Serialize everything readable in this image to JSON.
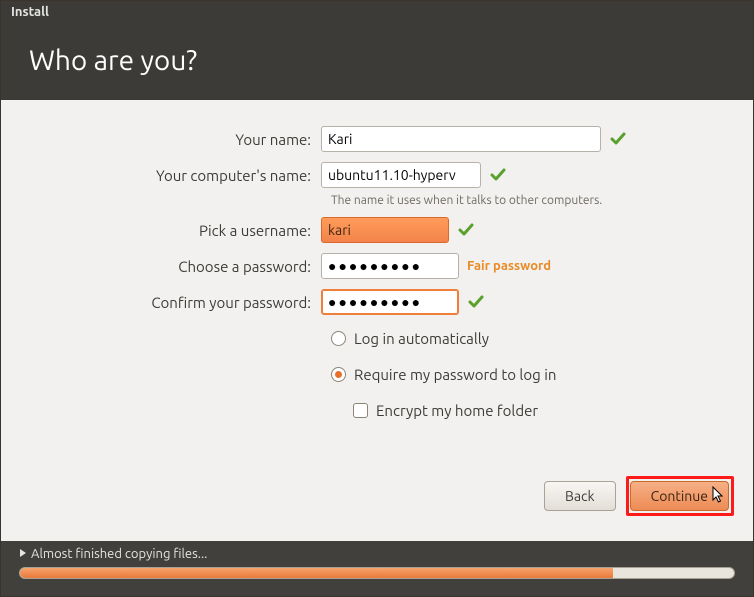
{
  "titlebar": "Install",
  "header_title": "Who are you?",
  "labels": {
    "your_name": "Your name:",
    "computer_name": "Your computer's name:",
    "computer_hint": "The name it uses when it talks to other computers.",
    "username": "Pick a username:",
    "password": "Choose a password:",
    "confirm": "Confirm your password:"
  },
  "values": {
    "your_name": "Kari",
    "computer_name": "ubuntu11.10-hyperv",
    "username": "kari",
    "password": "●●●●●●●●●",
    "confirm": "●●●●●●●●●"
  },
  "password_strength": "Fair password",
  "options": {
    "auto_login": "Log in automatically",
    "require_pw": "Require my password to log in",
    "encrypt": "Encrypt my home folder"
  },
  "buttons": {
    "back": "Back",
    "continue": "Continue"
  },
  "footer": {
    "status": "Almost finished copying files...",
    "progress_pct": 83
  }
}
